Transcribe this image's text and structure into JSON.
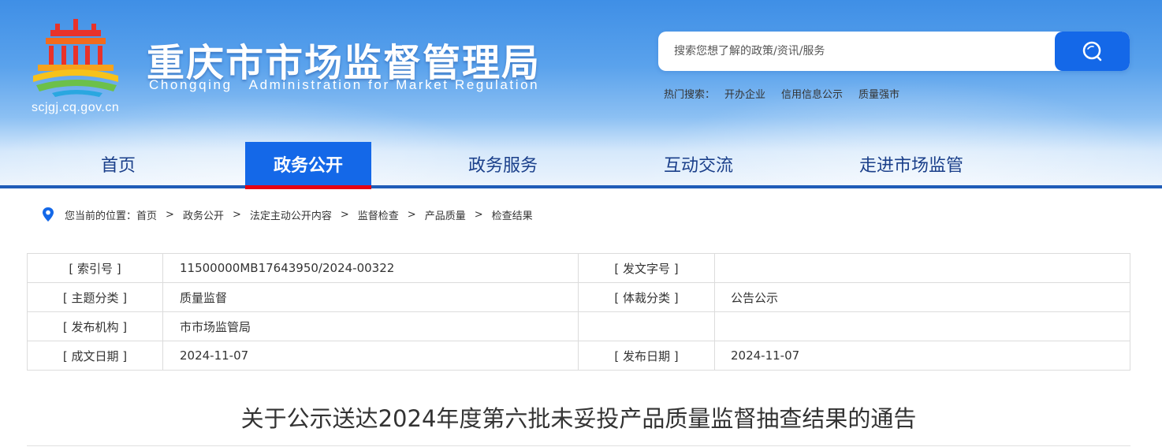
{
  "site": {
    "title_cn": "重庆市市场监督管理局",
    "title_en": "Chongqing   Administration for Market Regulation",
    "url": "scjgj.cq.gov.cn",
    "logo_icon": "chongqing-amr-logo-icon",
    "colors": {
      "brand_blue": "#1468e8",
      "nav_text": "#1a3f8a",
      "active_underline": "#e60012"
    }
  },
  "search": {
    "placeholder": "搜索您想了解的政策/资讯/服务",
    "button_icon": "search-icon",
    "hot_label": "热门搜索：",
    "hot_links": [
      "开办企业",
      "信用信息公示",
      "质量强市"
    ]
  },
  "nav": {
    "items": [
      "首页",
      "政务公开",
      "政务服务",
      "互动交流",
      "走进市场监管"
    ],
    "active": "政务公开"
  },
  "breadcrumb": {
    "prefix": "您当前的位置：",
    "items": [
      "首页",
      "政务公开",
      "法定主动公开内容",
      "监督检查",
      "产品质量",
      "检查结果"
    ],
    "separator": ">"
  },
  "info": {
    "index_label": "[ 索引号 ]",
    "index_value": "11500000MB17643950/2024-00322",
    "doc_no_label": "[ 发文字号 ]",
    "doc_no_value": "",
    "topic_label": "[ 主题分类 ]",
    "topic_value": "质量监督",
    "genre_label": "[ 体裁分类 ]",
    "genre_value": "公告公示",
    "org_label": "[ 发布机构 ]",
    "org_value": "市市场监管局",
    "created_label": "[ 成文日期 ]",
    "created_value": "2024-11-07",
    "published_label": "[ 发布日期 ]",
    "published_value": "2024-11-07"
  },
  "article": {
    "title": "关于公示送达2024年度第六批未妥投产品质量监督抽查结果的通告"
  }
}
